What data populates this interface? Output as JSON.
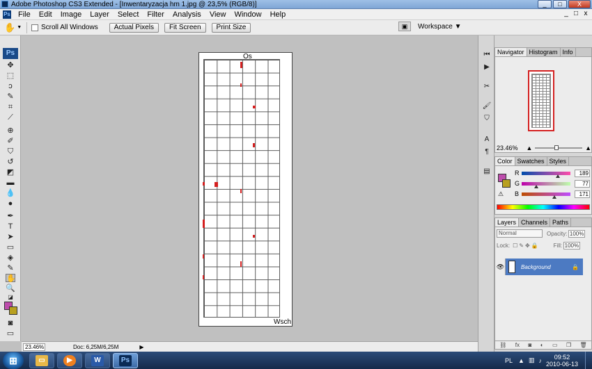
{
  "window": {
    "title": "Adobe Photoshop CS3 Extended - [Inwentaryzacja hm 1.jpg @ 23,5% (RGB/8)]",
    "controls": {
      "minimize": "_",
      "maximize": "□",
      "close": "X"
    }
  },
  "menu": {
    "logo": "Ps",
    "items": [
      "File",
      "Edit",
      "Image",
      "Layer",
      "Select",
      "Filter",
      "Analysis",
      "View",
      "Window",
      "Help"
    ],
    "mdi": [
      "_",
      "□",
      "x"
    ]
  },
  "options": {
    "scroll_all_windows": "Scroll All Windows",
    "actual_pixels": "Actual Pixels",
    "fit_screen": "Fit Screen",
    "print_size": "Print Size",
    "workspace": "Workspace ▼"
  },
  "toolbox": {
    "ps_label": "Ps"
  },
  "document": {
    "north_label": "Os",
    "east_label": "Wsch"
  },
  "navigator": {
    "tabs": [
      "Navigator",
      "Histogram",
      "Info"
    ],
    "zoom": "23.46%"
  },
  "color_panel": {
    "tabs": [
      "Color",
      "Swatches",
      "Styles"
    ],
    "channels": [
      {
        "label": "R",
        "value": "189",
        "fill": 0.74
      },
      {
        "label": "G",
        "value": "77",
        "fill": 0.3
      },
      {
        "label": "B",
        "value": "171",
        "fill": 0.67
      }
    ],
    "foreground": "#bd4dac",
    "background": "#b8a020"
  },
  "layers_panel": {
    "tabs": [
      "Layers",
      "Channels",
      "Paths"
    ],
    "blend_mode": "Normal",
    "opacity_label": "Opacity:",
    "opacity": "100%",
    "lock_label": "Lock:",
    "fill_label": "Fill:",
    "fill": "100%",
    "layer_name": "Background"
  },
  "status": {
    "zoom": "23.46%",
    "doc": "Doc: 6,25M/6,25M"
  },
  "taskbar": {
    "apps": [
      "explorer",
      "media-player",
      "word",
      "photoshop"
    ],
    "lang": "PL",
    "time": "09:52",
    "date": "2010-06-13"
  }
}
